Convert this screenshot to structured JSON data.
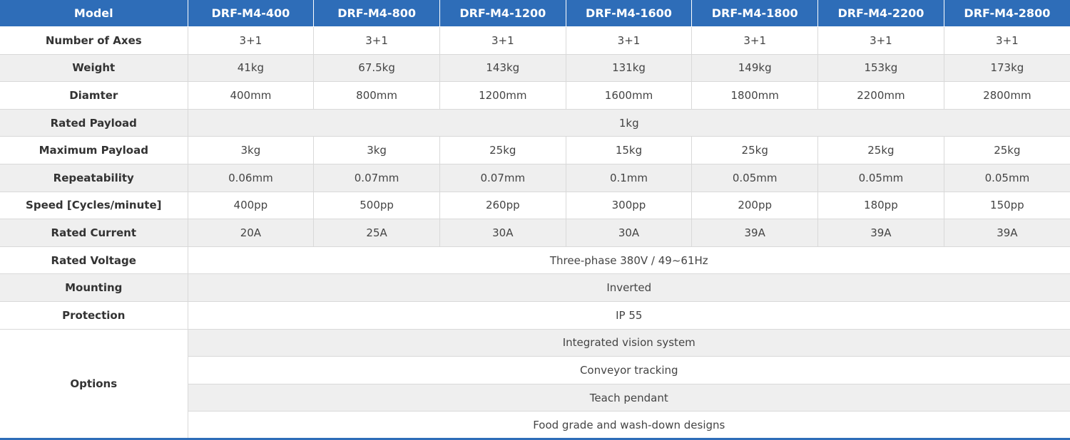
{
  "table": {
    "header_label": "Model",
    "models": [
      "DRF-M4-400",
      "DRF-M4-800",
      "DRF-M4-1200",
      "DRF-M4-1600",
      "DRF-M4-1800",
      "DRF-M4-2200",
      "DRF-M4-2800"
    ],
    "rows": {
      "axes": {
        "label": "Number of Axes",
        "values": [
          "3+1",
          "3+1",
          "3+1",
          "3+1",
          "3+1",
          "3+1",
          "3+1"
        ]
      },
      "weight": {
        "label": "Weight",
        "values": [
          "41kg",
          "67.5kg",
          "143kg",
          "131kg",
          "149kg",
          "153kg",
          "173kg"
        ]
      },
      "diameter": {
        "label": "Diamter",
        "values": [
          "400mm",
          "800mm",
          "1200mm",
          "1600mm",
          "1800mm",
          "2200mm",
          "2800mm"
        ]
      },
      "rated_payload": {
        "label": "Rated Payload",
        "value": "1kg"
      },
      "max_payload": {
        "label": "Maximum Payload",
        "values": [
          "3kg",
          "3kg",
          "25kg",
          "15kg",
          "25kg",
          "25kg",
          "25kg"
        ]
      },
      "repeatability": {
        "label": "Repeatability",
        "values": [
          "0.06mm",
          "0.07mm",
          "0.07mm",
          "0.1mm",
          "0.05mm",
          "0.05mm",
          "0.05mm"
        ]
      },
      "speed": {
        "label": "Speed [Cycles/minute]",
        "values": [
          "400pp",
          "500pp",
          "260pp",
          "300pp",
          "200pp",
          "180pp",
          "150pp"
        ]
      },
      "rated_current": {
        "label": "Rated Current",
        "values": [
          "20A",
          "25A",
          "30A",
          "30A",
          "39A",
          "39A",
          "39A"
        ]
      },
      "rated_voltage": {
        "label": "Rated Voltage",
        "value": "Three-phase 380V / 49~61Hz"
      },
      "mounting": {
        "label": "Mounting",
        "value": "Inverted"
      },
      "protection": {
        "label": "Protection",
        "value": "IP 55"
      },
      "options": {
        "label": "Options",
        "values": [
          "Integrated vision system",
          "Conveyor tracking",
          "Teach pendant",
          "Food grade and wash-down designs"
        ]
      }
    }
  },
  "colors": {
    "header_bg": "#2e6db8",
    "header_text": "#ffffff",
    "row_shade": "#efefef",
    "border": "#d9d9d9"
  }
}
